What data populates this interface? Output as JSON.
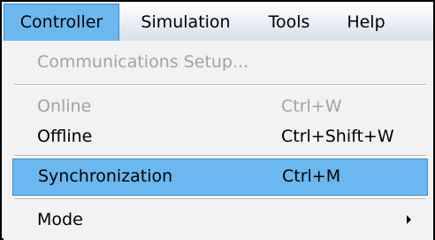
{
  "menubar": {
    "items": [
      {
        "label": "Controller",
        "active": true
      },
      {
        "label": "Simulation",
        "active": false
      },
      {
        "label": "Tools",
        "active": false
      },
      {
        "label": "Help",
        "active": false
      }
    ]
  },
  "menu": {
    "items": [
      {
        "label": "Communications Setup...",
        "shortcut": "",
        "enabled": false
      },
      {
        "label": "Online",
        "shortcut": "Ctrl+W",
        "enabled": false
      },
      {
        "label": "Offline",
        "shortcut": "Ctrl+Shift+W",
        "enabled": true
      },
      {
        "label": "Synchronization",
        "shortcut": "Ctrl+M",
        "enabled": true,
        "highlighted": true
      },
      {
        "label": "Mode",
        "shortcut": "",
        "enabled": true,
        "has_submenu": true
      }
    ]
  },
  "colors": {
    "highlight": "#6ab8ef",
    "highlight_border": "#3c8fd0",
    "disabled_text": "#a3a3a3",
    "menu_background": "#f2f2f2"
  },
  "icons": {
    "submenu": "chevron-right-icon"
  }
}
